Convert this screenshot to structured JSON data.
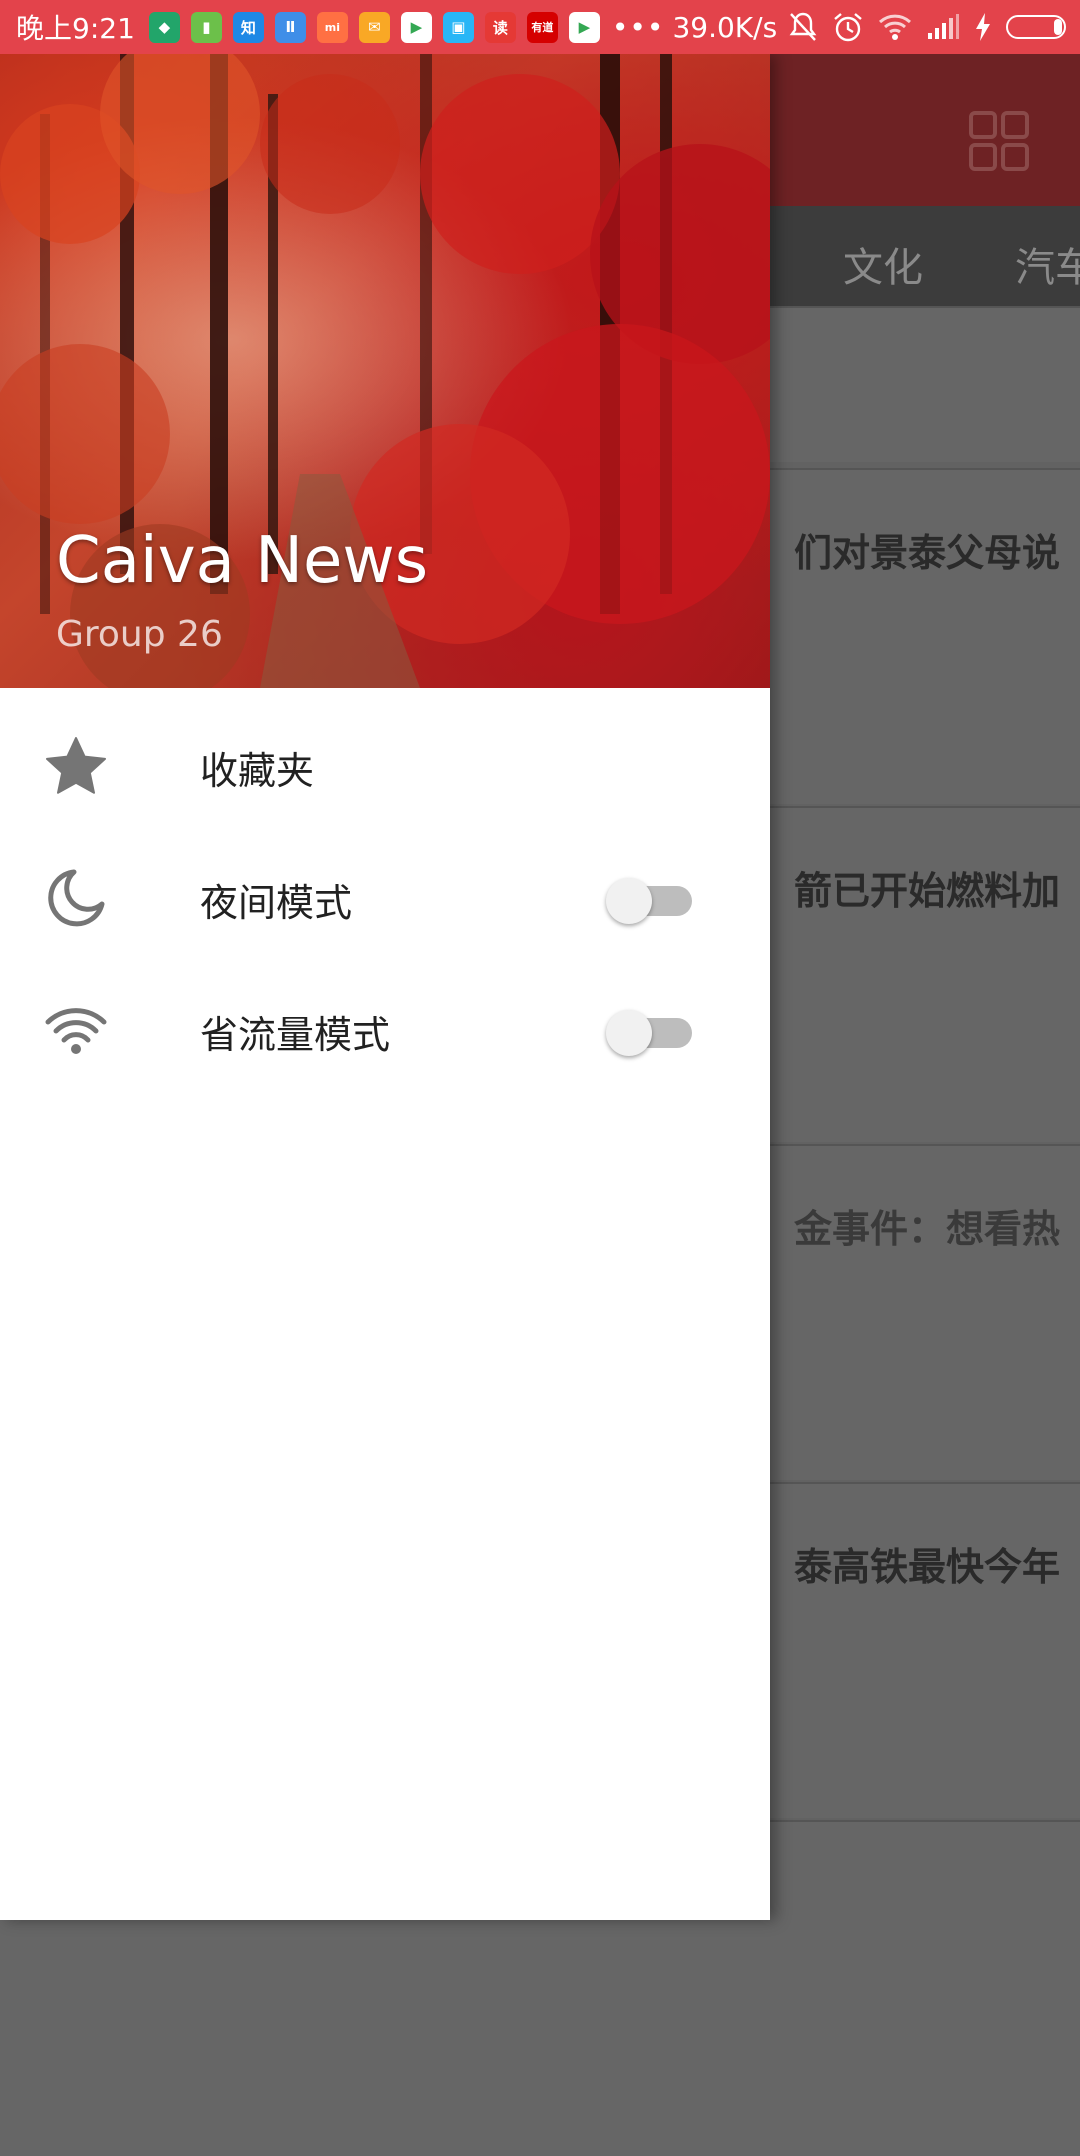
{
  "status_bar": {
    "time": "晚上9:21",
    "network_speed": "39.0K/s",
    "more_indicator": "•••",
    "apps": [
      {
        "name": "shield-app-icon",
        "color": "#22a56a",
        "glyph": "◆"
      },
      {
        "name": "battery-app-icon",
        "color": "#6cc04a",
        "glyph": "▮"
      },
      {
        "name": "zhihu-app-icon",
        "color": "#1e88e5",
        "glyph": "知"
      },
      {
        "name": "book-app-icon",
        "color": "#3f8ee8",
        "glyph": "Ⅱ"
      },
      {
        "name": "mi-store-app-icon",
        "color": "#ff7043",
        "glyph": "mi"
      },
      {
        "name": "mail-app-icon",
        "color": "#f9a825",
        "glyph": "✉"
      },
      {
        "name": "video-app-icon",
        "color": "#ffffff",
        "glyph": "▶"
      },
      {
        "name": "box-app-icon",
        "color": "#29b6f6",
        "glyph": "▣"
      },
      {
        "name": "read-app-icon",
        "color": "#e53935",
        "glyph": "读"
      },
      {
        "name": "youdao-app-icon",
        "color": "#d50000",
        "glyph": "有道"
      },
      {
        "name": "player-app-icon",
        "color": "#ffffff",
        "glyph": "▶"
      }
    ]
  },
  "drawer": {
    "header": {
      "title": "Caiva News",
      "subtitle": "Group 26"
    },
    "menu": [
      {
        "label": "收藏夹",
        "icon": "star-icon"
      },
      {
        "label": "夜间模式",
        "icon": "moon-icon",
        "toggle": false
      },
      {
        "label": "省流量模式",
        "icon": "wifi-icon",
        "toggle": false
      }
    ]
  },
  "background": {
    "tabs": [
      "文化",
      "汽车"
    ],
    "news": [
      "们对景泰父母说",
      "箭已开始燃料加",
      "金事件：想看热",
      "泰高铁最快今年"
    ]
  },
  "colors": {
    "status_bar": "#e3434b",
    "toolbar": "#6e2224",
    "tabs_bar": "#3c3c3c",
    "scrim": "#626262"
  }
}
